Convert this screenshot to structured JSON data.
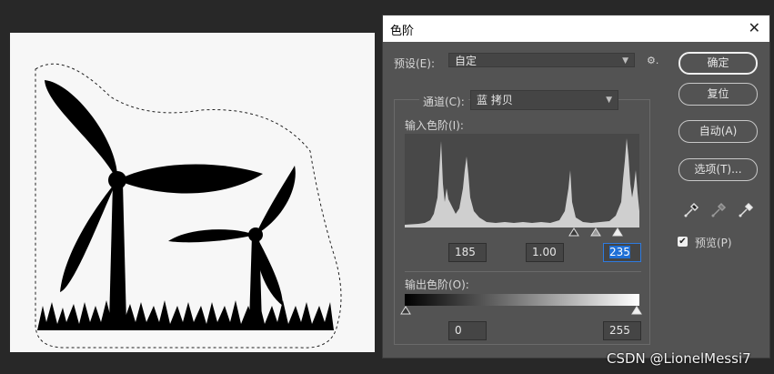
{
  "dialog": {
    "title": "色阶",
    "close_glyph": "✕",
    "preset_label": "预设(E):",
    "preset_value": "自定",
    "gear_glyph": "⚙.",
    "channel_label": "通道(C):",
    "channel_value": "蓝 拷贝",
    "input_levels_label": "输入色阶(I):",
    "input_black": "185",
    "input_gamma": "1.00",
    "input_white": "235",
    "output_levels_label": "输出色阶(O):",
    "output_black": "0",
    "output_white": "255",
    "buttons": {
      "ok": "确定",
      "reset": "复位",
      "auto": "自动(A)",
      "options": "选项(T)..."
    },
    "preview_label": "预览(P)",
    "preview_checked": true
  },
  "watermark": "CSDN @LionelMessi7"
}
